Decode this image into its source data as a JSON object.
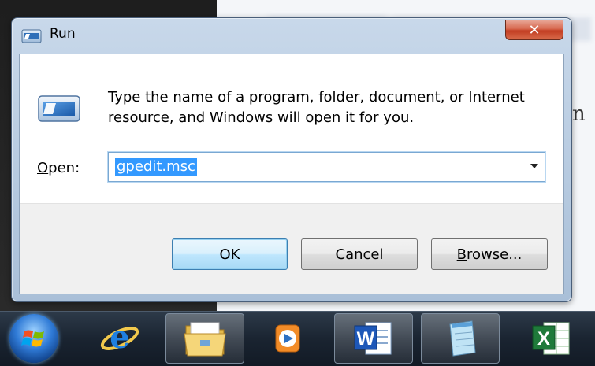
{
  "dialog": {
    "title": "Run",
    "close_glyph": "✕",
    "description": "Type the name of a program, folder, document, or Internet resource, and Windows will open it for you.",
    "open_label_prefix": "",
    "open_label_underlined": "O",
    "open_label_rest": "pen:",
    "open_value": "gpedit.msc",
    "buttons": {
      "ok": "OK",
      "cancel": "Cancel",
      "browse_underlined": "B",
      "browse_rest": "rowse..."
    }
  },
  "background": {
    "right_text": "n"
  },
  "taskbar": {
    "items": [
      {
        "name": "start-orb",
        "icon": "windows-logo-icon"
      },
      {
        "name": "internet-explorer",
        "icon": "internet-explorer-icon"
      },
      {
        "name": "windows-explorer",
        "icon": "folder-icon"
      },
      {
        "name": "media-player",
        "icon": "media-player-icon"
      },
      {
        "name": "word",
        "icon": "word-icon",
        "glyph": "W"
      },
      {
        "name": "notepad",
        "icon": "notepad-icon"
      },
      {
        "name": "excel",
        "icon": "excel-icon",
        "glyph": "X"
      }
    ]
  },
  "colors": {
    "selection": "#3399ff",
    "close_red": "#c23d22",
    "taskbar": "#1a2431"
  }
}
